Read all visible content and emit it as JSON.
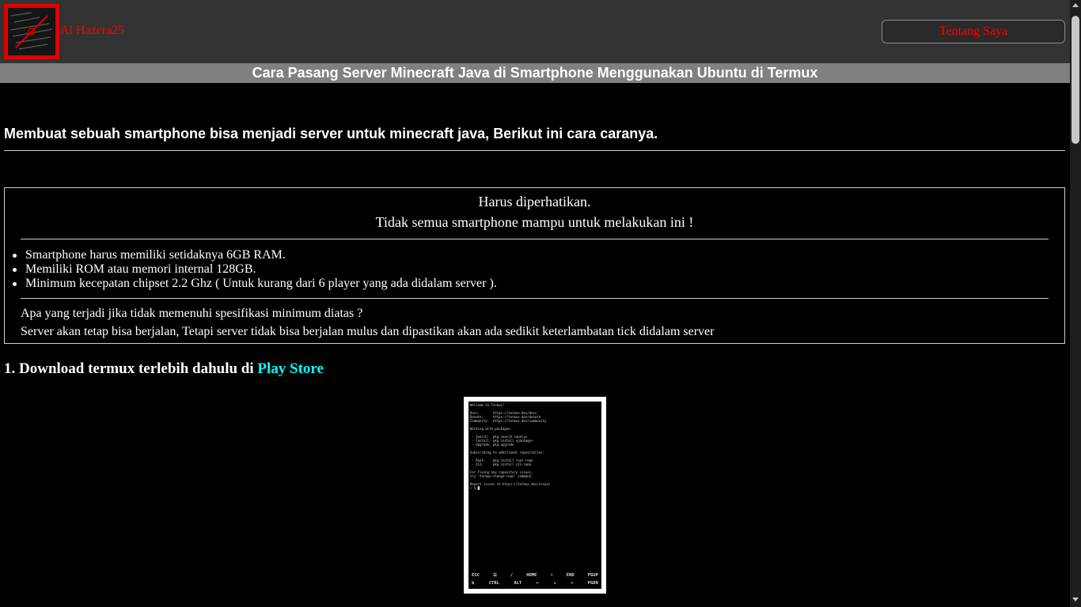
{
  "header": {
    "site_name": "Al Hazera25",
    "about_button": "Tentang Saya",
    "logo_icon": "site-logo-icon"
  },
  "page": {
    "title": "Cara Pasang Server Minecraft Java di Smartphone Menggunakan Ubuntu di Termux",
    "intro": "Membuat sebuah smartphone bisa menjadi server untuk minecraft java, Berikut ini cara caranya."
  },
  "notice": {
    "heading": "Harus diperhatikan.",
    "subheading": "Tidak semua smartphone mampu untuk melakukan ini !",
    "requirements": [
      "Smartphone harus memiliki setidaknya 6GB RAM.",
      "Memiliki ROM atau memori internal 128GB.",
      "Minimum kecepatan chipset 2.2 Ghz ( Untuk kurang dari 6 player yang ada didalam server )."
    ],
    "question": "Apa yang terjadi jika tidak memenuhi spesifikasi minimum diatas ?",
    "answer": "Server akan tetap bisa berjalan, Tetapi server tidak bisa berjalan mulus dan dipastikan akan ada sedikit keterlambatan tick didalam server"
  },
  "step1": {
    "text": "1. Download termux terlebih dahulu di ",
    "link": "Play Store"
  },
  "termux_screenshot": {
    "lines": [
      "Welcome to Termux!",
      "",
      "Docs:       https://termux.dev/docs",
      "Donate:     https://termux.dev/donate",
      "Community:  https://termux.dev/community",
      "",
      "Working with packages:",
      "",
      " - Search:  pkg search <query>",
      " - Install: pkg install <package>",
      " - Upgrade: pkg upgrade",
      "",
      "Subscribing to additional repositories:",
      "",
      " - Root:    pkg install root-repo",
      " - X11:     pkg install x11-repo",
      "",
      "For fixing any repository issues,",
      "try 'termux-change-repo' command.",
      "",
      "Report issues at https://termux.dev/issues",
      "~ $ █"
    ],
    "keys_row1": [
      "ESC",
      "☰",
      "/",
      "HOME",
      "↑",
      "END",
      "PGUP"
    ],
    "keys_row2": [
      "↹",
      "CTRL",
      "ALT",
      "←",
      "↓",
      "→",
      "PGDN"
    ]
  },
  "colors": {
    "accent_red": "#ff0000",
    "link_cyan": "#00ffff",
    "header_bg": "#333333",
    "title_bar_bg": "#808080"
  }
}
